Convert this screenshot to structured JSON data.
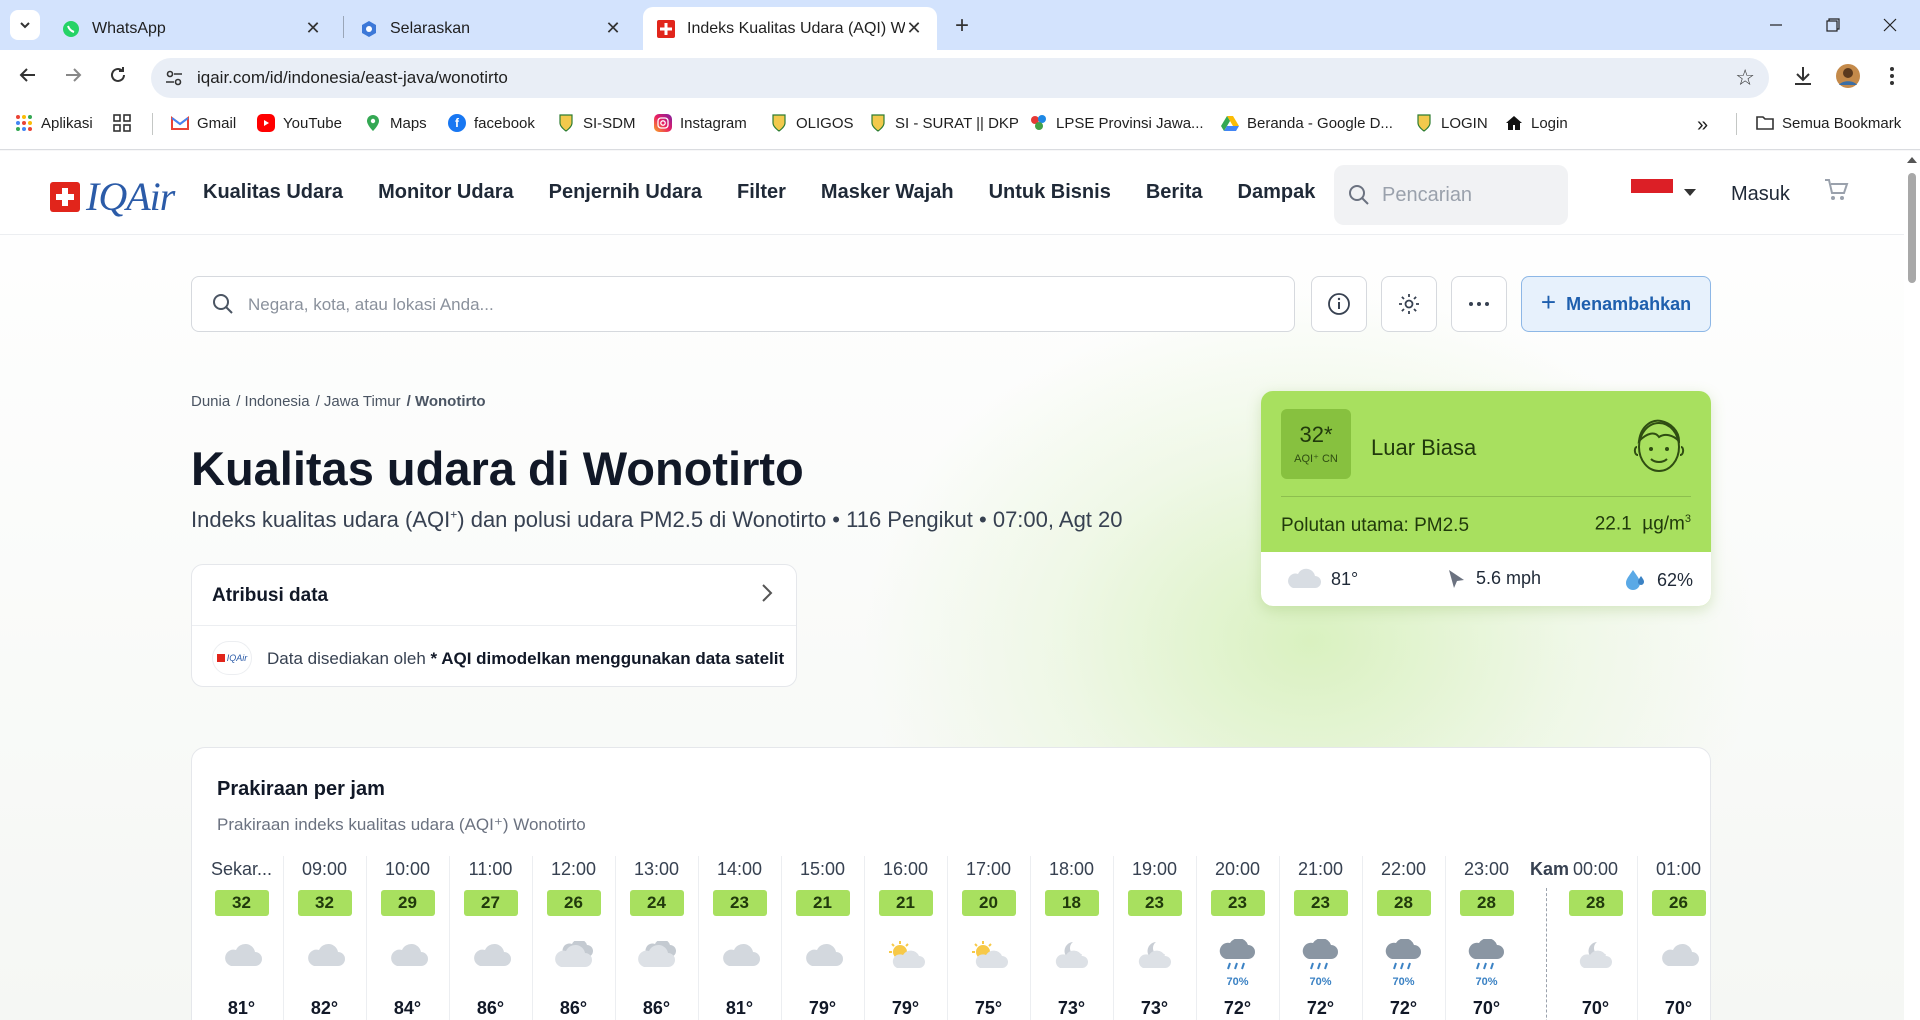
{
  "browser": {
    "tabs": [
      {
        "title": "WhatsApp",
        "icon": "whatsapp-icon"
      },
      {
        "title": "Selaraskan",
        "icon": "selaraskan-icon"
      },
      {
        "title": "Indeks Kualitas Udara (AQI) Wo",
        "icon": "iqair-icon",
        "active": true
      }
    ],
    "url": "iqair.com/id/indonesia/east-java/wonotirto",
    "bookmarks": [
      {
        "label": "Aplikasi",
        "icon": "apps-grid-icon"
      },
      {
        "label": "",
        "icon": "grid-icon"
      },
      {
        "label": "Gmail",
        "icon": "gmail-icon"
      },
      {
        "label": "YouTube",
        "icon": "youtube-icon"
      },
      {
        "label": "Maps",
        "icon": "maps-pin-icon"
      },
      {
        "label": "facebook",
        "icon": "facebook-icon"
      },
      {
        "label": "SI-SDM",
        "icon": "crest-icon"
      },
      {
        "label": "Instagram",
        "icon": "instagram-icon"
      },
      {
        "label": "OLIGOS",
        "icon": "crest-icon"
      },
      {
        "label": "SI - SURAT || DKP",
        "icon": "crest-icon"
      },
      {
        "label": "LPSE Provinsi Jawa...",
        "icon": "lpse-icon"
      },
      {
        "label": "Beranda - Google D...",
        "icon": "google-drive-icon"
      },
      {
        "label": "LOGIN",
        "icon": "crest-icon"
      },
      {
        "label": "Login",
        "icon": "home-icon"
      }
    ],
    "all_bookmarks": "Semua Bookmark",
    "overflow": "»"
  },
  "site": {
    "logo_text": "IQAir",
    "nav": [
      "Kualitas Udara",
      "Monitor Udara",
      "Penjernih Udara",
      "Filter",
      "Masker Wajah",
      "Untuk Bisnis",
      "Berita",
      "Dampak"
    ],
    "search_placeholder": "Pencarian",
    "login": "Masuk"
  },
  "location_search": {
    "placeholder": "Negara, kota, atau lokasi Anda...",
    "add_label": "Menambahkan"
  },
  "breadcrumbs": [
    "Dunia",
    "/ Indonesia",
    "/ Jawa Timur",
    "/ Wonotirto"
  ],
  "title": "Kualitas udara di Wonotirto",
  "subtitle": {
    "pre": "Indeks kualitas udara (AQI",
    "sup": "+",
    "post": ") dan polusi udara PM2.5 di Wonotirto • 116 Pengikut • 07:00, Agt 20"
  },
  "attribution": {
    "heading": "Atribusi data",
    "logo": "IQAir",
    "text": "Data disediakan oleh",
    "bold": "* AQI dimodelkan menggunakan data satelit"
  },
  "aqi": {
    "value": "32*",
    "unit_label": "AQI⁺ CN",
    "status": "Luar Biasa",
    "pollutant_label": "Polutan utama:",
    "pollutant": "PM2.5",
    "concentration": "22.1",
    "concentration_unit": "µg/m",
    "unit_sup": "3",
    "temperature": "81°",
    "wind": "5.6 mph",
    "humidity": "62%",
    "color": "#a8e05f"
  },
  "forecast": {
    "title": "Prakiraan per jam",
    "subtitle": "Prakiraan indeks kualitas udara (AQI⁺) Wonotirto",
    "day_label": "Kam",
    "hours": [
      {
        "hour": "Sekar...",
        "aqi": "32",
        "icon": "cloud-icon",
        "rain": "",
        "temp": "81°"
      },
      {
        "hour": "09:00",
        "aqi": "32",
        "icon": "cloud-icon",
        "rain": "",
        "temp": "82°"
      },
      {
        "hour": "10:00",
        "aqi": "29",
        "icon": "cloud-icon",
        "rain": "",
        "temp": "84°"
      },
      {
        "hour": "11:00",
        "aqi": "27",
        "icon": "cloud-icon",
        "rain": "",
        "temp": "86°"
      },
      {
        "hour": "12:00",
        "aqi": "26",
        "icon": "clouds-icon",
        "rain": "",
        "temp": "86°"
      },
      {
        "hour": "13:00",
        "aqi": "24",
        "icon": "clouds-icon",
        "rain": "",
        "temp": "86°"
      },
      {
        "hour": "14:00",
        "aqi": "23",
        "icon": "cloud-icon",
        "rain": "",
        "temp": "81°"
      },
      {
        "hour": "15:00",
        "aqi": "21",
        "icon": "cloud-icon",
        "rain": "",
        "temp": "79°"
      },
      {
        "hour": "16:00",
        "aqi": "21",
        "icon": "sun-cloud-icon",
        "rain": "",
        "temp": "79°"
      },
      {
        "hour": "17:00",
        "aqi": "20",
        "icon": "sun-cloud-icon",
        "rain": "",
        "temp": "75°"
      },
      {
        "hour": "18:00",
        "aqi": "18",
        "icon": "moon-cloud-icon",
        "rain": "",
        "temp": "73°"
      },
      {
        "hour": "19:00",
        "aqi": "23",
        "icon": "moon-cloud-icon",
        "rain": "",
        "temp": "73°"
      },
      {
        "hour": "20:00",
        "aqi": "23",
        "icon": "rain-cloud-icon",
        "rain": "70%",
        "temp": "72°"
      },
      {
        "hour": "21:00",
        "aqi": "23",
        "icon": "rain-cloud-icon",
        "rain": "70%",
        "temp": "72°"
      },
      {
        "hour": "22:00",
        "aqi": "28",
        "icon": "rain-cloud-icon",
        "rain": "70%",
        "temp": "72°"
      },
      {
        "hour": "23:00",
        "aqi": "28",
        "icon": "rain-cloud-icon",
        "rain": "70%",
        "temp": "70°"
      },
      {
        "hour": "00:00",
        "aqi": "28",
        "icon": "moon-cloud-icon",
        "rain": "",
        "temp": "70°"
      },
      {
        "hour": "01:00",
        "aqi": "26",
        "icon": "cloud-icon",
        "rain": "",
        "temp": "70°"
      }
    ]
  }
}
